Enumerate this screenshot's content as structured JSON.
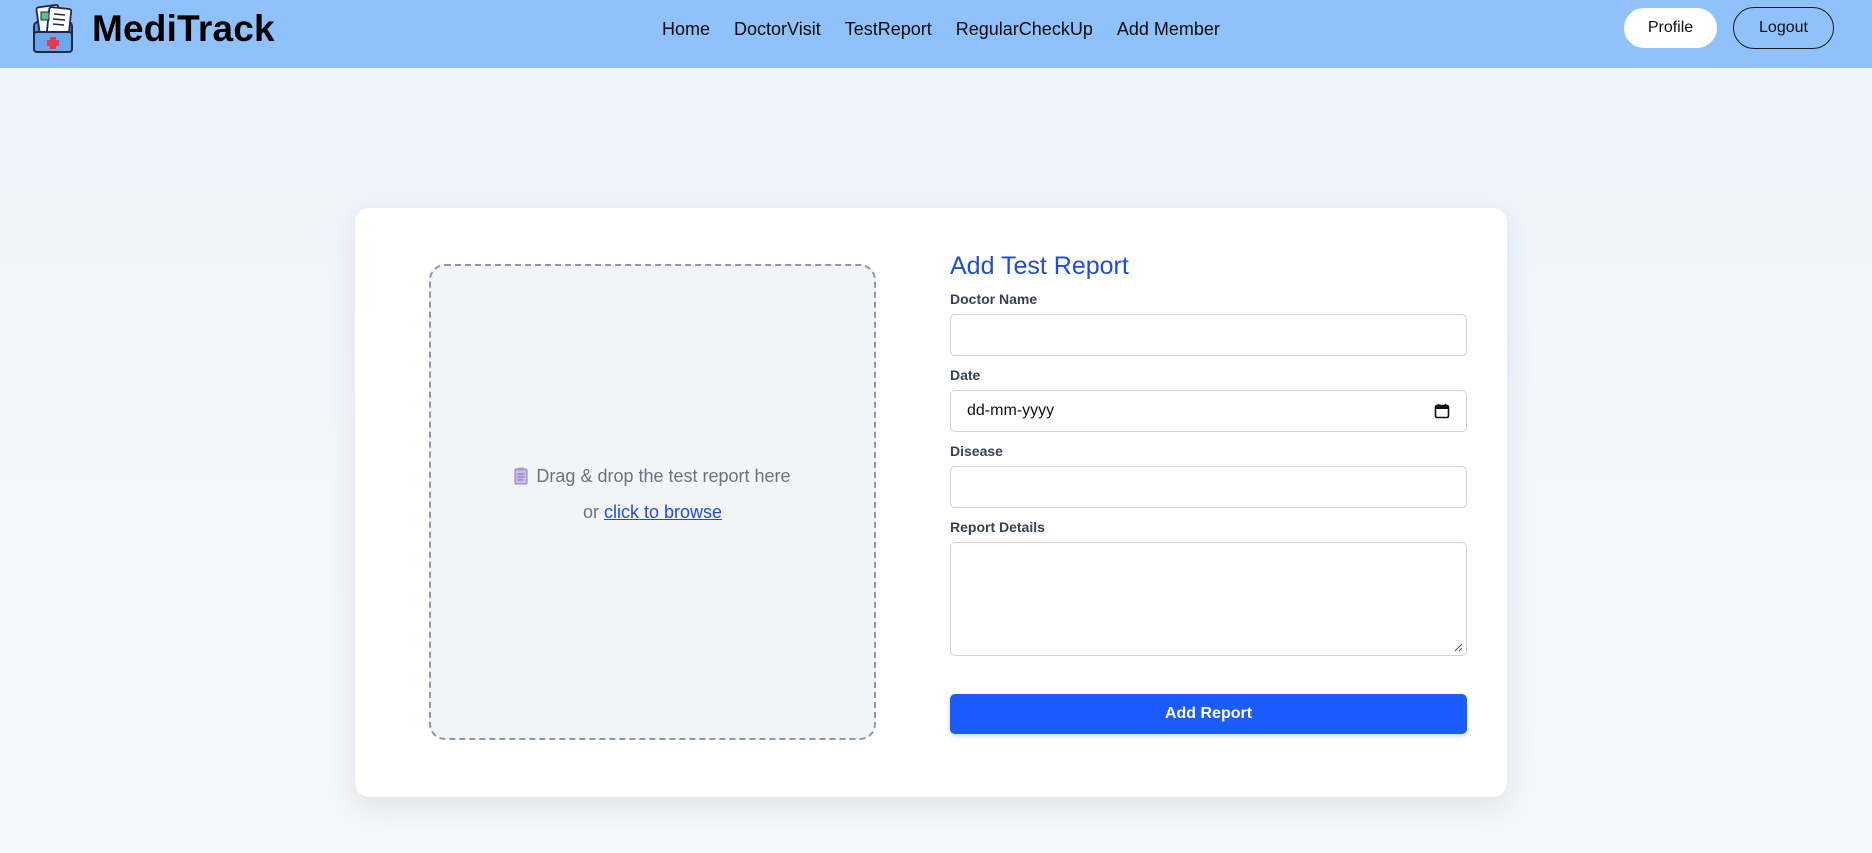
{
  "app": {
    "name": "MediTrack"
  },
  "nav": {
    "links": [
      {
        "label": "Home"
      },
      {
        "label": "DoctorVisit"
      },
      {
        "label": "TestReport"
      },
      {
        "label": "RegularCheckUp"
      },
      {
        "label": "Add Member"
      }
    ],
    "profile_label": "Profile",
    "logout_label": "Logout"
  },
  "upload": {
    "icon": "clipboard-icon",
    "prompt": "Drag & drop the test report here",
    "or_text": "or",
    "browse_label": "click to browse"
  },
  "form": {
    "title": "Add Test Report",
    "doctor_name": {
      "label": "Doctor Name",
      "value": ""
    },
    "date": {
      "label": "Date",
      "placeholder": "dd-mm-yyyy"
    },
    "disease": {
      "label": "Disease",
      "value": ""
    },
    "report_details": {
      "label": "Report Details",
      "value": ""
    },
    "submit_label": "Add Report"
  },
  "colors": {
    "navbar": "#8fc1fb",
    "accent": "#1d4ed8",
    "primary_button": "#1b5cff"
  }
}
